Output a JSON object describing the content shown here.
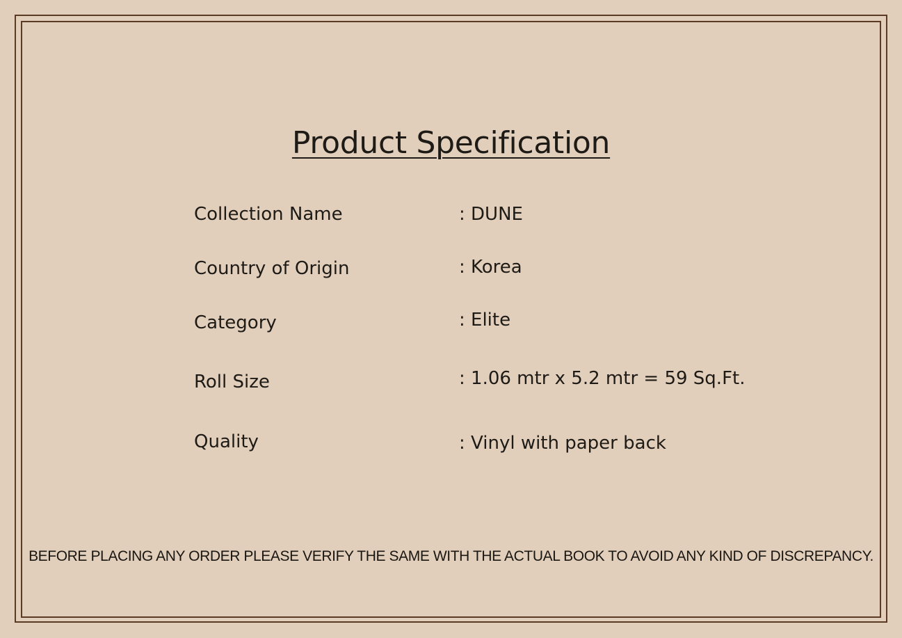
{
  "title": "Product Specification",
  "specs": [
    {
      "label": "Collection Name",
      "value": ": DUNE"
    },
    {
      "label": "Country of Origin",
      "value": ": Korea"
    },
    {
      "label": "Category",
      "value": ": Elite"
    },
    {
      "label": "Roll Size",
      "value": ": 1.06 mtr x 5.2 mtr = 59 Sq.Ft."
    },
    {
      "label": "Quality",
      "value": ": Vinyl with paper back"
    }
  ],
  "notice": "BEFORE PLACING ANY ORDER PLEASE VERIFY THE SAME WITH THE ACTUAL BOOK TO AVOID ANY KIND OF DISCREPANCY.",
  "colors": {
    "background": "#e1cfbb",
    "border": "#5a3a22",
    "text": "#1e1a16"
  }
}
